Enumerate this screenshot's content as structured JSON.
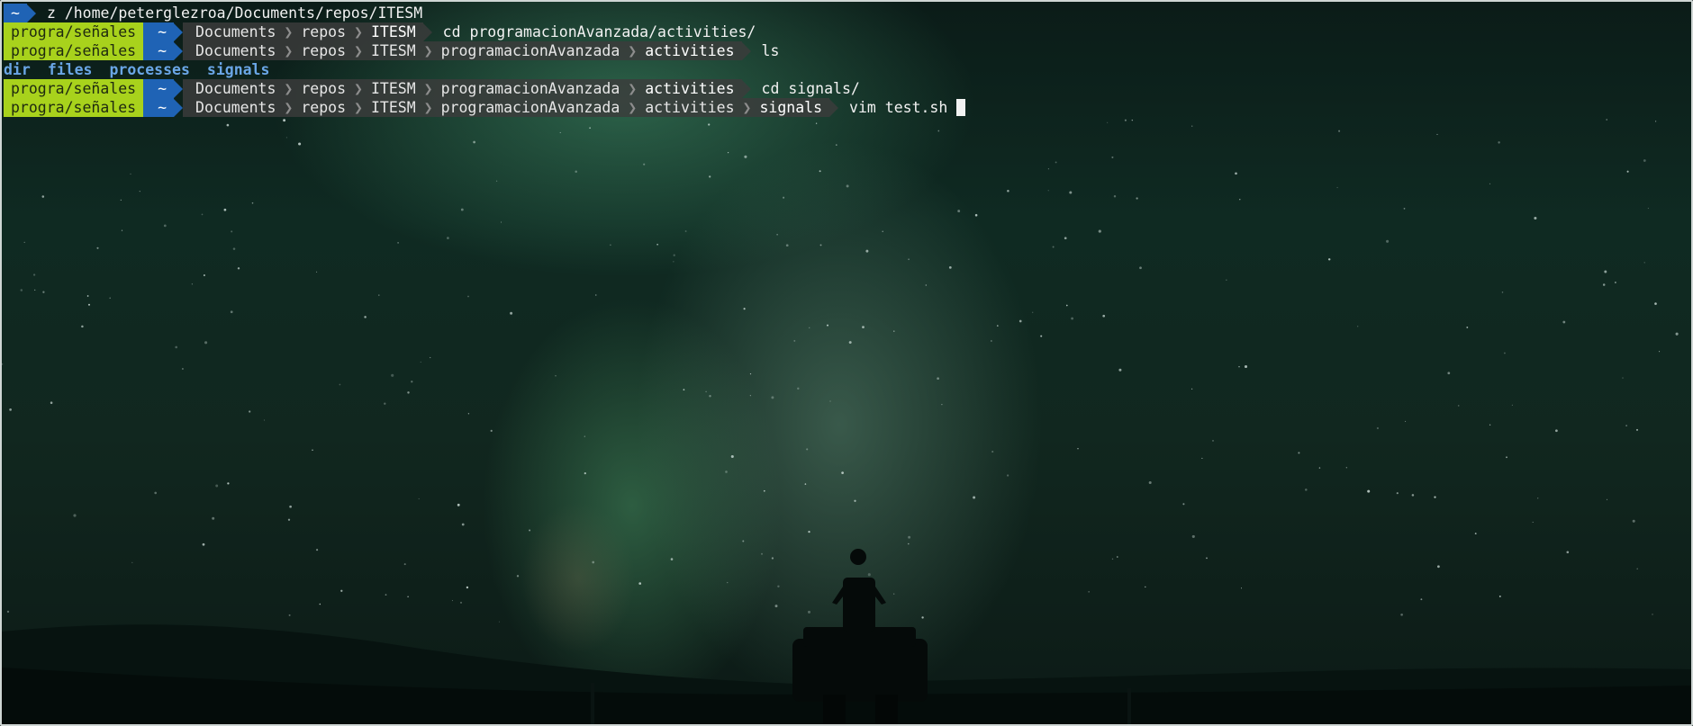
{
  "terminal": {
    "z_line": {
      "home": "~",
      "command": "z /home/peterglezroa/Documents/repos/ITESM"
    },
    "prompts": [
      {
        "git": "progra/señales",
        "home": "~",
        "path": [
          "Documents",
          "repos",
          "ITESM"
        ],
        "command": "cd programacionAvanzada/activities/"
      },
      {
        "git": "progra/señales",
        "home": "~",
        "path": [
          "Documents",
          "repos",
          "ITESM",
          "programacionAvanzada",
          "activities"
        ],
        "command": "ls"
      }
    ],
    "ls_output": [
      "dir",
      "files",
      "processes",
      "signals"
    ],
    "prompts_after": [
      {
        "git": "progra/señales",
        "home": "~",
        "path": [
          "Documents",
          "repos",
          "ITESM",
          "programacionAvanzada",
          "activities"
        ],
        "command": "cd signals/"
      },
      {
        "git": "progra/señales",
        "home": "~",
        "path": [
          "Documents",
          "repos",
          "ITESM",
          "programacionAvanzada",
          "activities",
          "signals"
        ],
        "command": "vim test.sh"
      }
    ]
  },
  "colors": {
    "git_segment": "#a8d21c",
    "home_segment": "#1f63b5",
    "path_segment": "#3c3c3c",
    "ls_directory": "#6aa6e6"
  },
  "background": {
    "icons": [
      "aurora-icon",
      "stars-icon",
      "person-on-car-icon"
    ]
  }
}
